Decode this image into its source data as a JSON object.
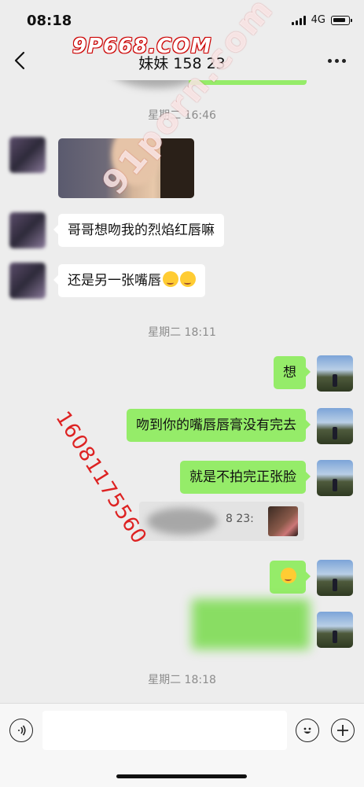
{
  "status": {
    "time": "08:18",
    "network": "4G"
  },
  "nav": {
    "title": "妹妹 158 23"
  },
  "watermarks": {
    "top": "9P668.COM",
    "diagonal": "91porn.com",
    "phone": "16081175560"
  },
  "messages": {
    "ts1": "星期二 16:46",
    "m1": "哥哥想吻我的烈焰红唇嘛",
    "m2": "还是另一张嘴唇",
    "ts2": "星期二 18:11",
    "r1": "想",
    "r2": "吻到你的嘴唇唇膏没有完去",
    "r3": "就是不拍完正张脸",
    "quote": "8  23:",
    "ts3": "星期二 18:18"
  },
  "icons": {
    "back": "chevron-left-icon",
    "more": "more-dots-icon",
    "voice": "voice-icon",
    "emoji": "emoji-icon",
    "plus": "plus-icon"
  }
}
